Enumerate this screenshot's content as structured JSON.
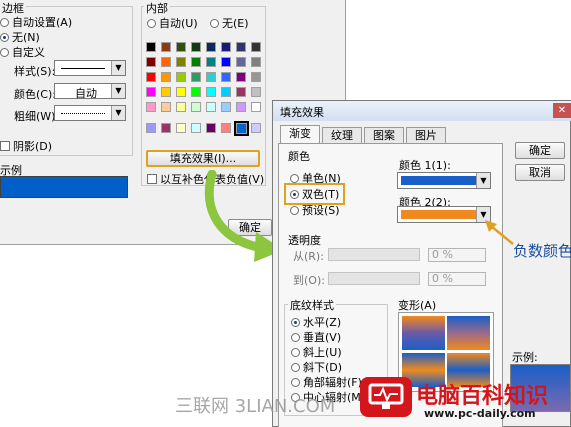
{
  "left_dialog": {
    "border_group": {
      "title": "边框",
      "options": [
        {
          "label": "自动设置(A)",
          "selected": false
        },
        {
          "label": "无(N)",
          "selected": true
        },
        {
          "label": "自定义",
          "selected": false
        }
      ],
      "style_label": "样式(S):",
      "color_label": "颜色(C):",
      "color_value": "自动",
      "weight_label": "粗细(W):"
    },
    "shadow_label": "阴影(D)",
    "preview_label": "示例",
    "preview_color": "#0060c8"
  },
  "inner_group": {
    "title": "内部",
    "auto_label": "自动(U)",
    "none_label": "无(E)",
    "palette_row_colors": [
      [
        "#000000",
        "#8b3a12",
        "#334c0f",
        "#0f3d0f",
        "#0b2a5e",
        "#1a1a7a",
        "#33336b",
        "#333333"
      ],
      [
        "#800000",
        "#ff6600",
        "#808000",
        "#008000",
        "#008080",
        "#0000ff",
        "#666699",
        "#808080"
      ],
      [
        "#ff0000",
        "#ff9900",
        "#99cc00",
        "#339966",
        "#33cccc",
        "#3366ff",
        "#800080",
        "#969696"
      ],
      [
        "#ff00ff",
        "#ffcc00",
        "#ffff00",
        "#00ff00",
        "#00ffff",
        "#00ccff",
        "#993366",
        "#c0c0c0"
      ],
      [
        "#ff99cc",
        "#ffcc99",
        "#ffff99",
        "#ccffcc",
        "#ccffff",
        "#99ccff",
        "#cc99ff",
        "#ffffff"
      ]
    ],
    "recent_colors": [
      "#9999ff",
      "#993366",
      "#ffffcc",
      "#ccffff",
      "#660066",
      "#ff8080",
      "#0066cc",
      "#ccccff"
    ],
    "fill_effects_button": "填充效果(I)...",
    "complement_label": "以互补色代表负值(V)"
  },
  "ok_button_back": "确定",
  "fill_dialog": {
    "title": "填充效果",
    "close_icon": "close-icon",
    "tabs": [
      "渐变",
      "纹理",
      "图案",
      "图片"
    ],
    "active_tab": 0,
    "colors_group": {
      "title": "颜色",
      "options": [
        {
          "label": "单色(N)",
          "selected": false
        },
        {
          "label": "双色(T)",
          "selected": true
        },
        {
          "label": "预设(S)",
          "selected": false
        }
      ],
      "color1_label": "颜色 1(1):",
      "color1_value": "#1a5fc8",
      "color2_label": "颜色 2(2):",
      "color2_value": "#f08a1e"
    },
    "transparency_group": {
      "title": "透明度",
      "from_label": "从(R):",
      "from_value": "0 %",
      "to_label": "到(O):",
      "to_value": "0 %"
    },
    "shading_group": {
      "title": "底纹样式",
      "options": [
        {
          "label": "水平(Z)",
          "selected": true
        },
        {
          "label": "垂直(V)",
          "selected": false
        },
        {
          "label": "斜上(U)",
          "selected": false
        },
        {
          "label": "斜下(D)",
          "selected": false
        },
        {
          "label": "角部辐射(F)",
          "selected": false
        },
        {
          "label": "中心辐射(M)",
          "selected": false
        }
      ]
    },
    "variants_label": "变形(A)",
    "ok_button": "确定",
    "cancel_button": "取消",
    "sample_label": "示例:"
  },
  "annotation_label": "负数颜色",
  "watermark_left": "三联网 3LIAN.COM",
  "logo": {
    "text": "电脑百科知识",
    "url": "www.pc-daily.com"
  },
  "colors": {
    "highlight_border": "#e0a020",
    "arrow_green": "#8cc63f",
    "annotation_blue": "#1a4fa0",
    "logo_red": "#d4151c"
  }
}
